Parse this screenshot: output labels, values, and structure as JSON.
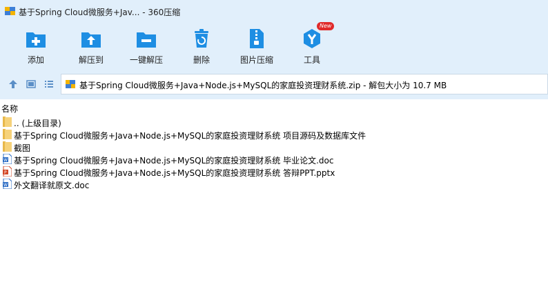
{
  "window": {
    "title": "基于Spring Cloud微服务+Jav... - 360压缩"
  },
  "toolbar": {
    "add_label": "添加",
    "extract_to_label": "解压到",
    "one_click_extract_label": "一键解压",
    "delete_label": "删除",
    "image_compress_label": "图片压缩",
    "tools_label": "工具",
    "tools_badge": "New"
  },
  "address": {
    "text": "基于Spring Cloud微服务+Java+Node.js+MySQL的家庭投资理财系统.zip - 解包大小为 10.7 MB"
  },
  "list": {
    "column_name": "名称",
    "items": [
      {
        "name": ".. (上级目录)",
        "type": "folder"
      },
      {
        "name": "基于Spring Cloud微服务+Java+Node.js+MySQL的家庭投资理财系统 项目源码及数据库文件",
        "type": "folder"
      },
      {
        "name": "截图",
        "type": "folder"
      },
      {
        "name": "基于Spring Cloud微服务+Java+Node.js+MySQL的家庭投资理财系统 毕业论文.doc",
        "type": "doc"
      },
      {
        "name": "基于Spring Cloud微服务+Java+Node.js+MySQL的家庭投资理财系统 答辩PPT.pptx",
        "type": "pptx"
      },
      {
        "name": "外文翻译就原文.doc",
        "type": "doc"
      }
    ]
  },
  "colors": {
    "header_bg": "#e1effb",
    "icon_blue": "#1e8ee3",
    "badge_red": "#e02a2a"
  }
}
